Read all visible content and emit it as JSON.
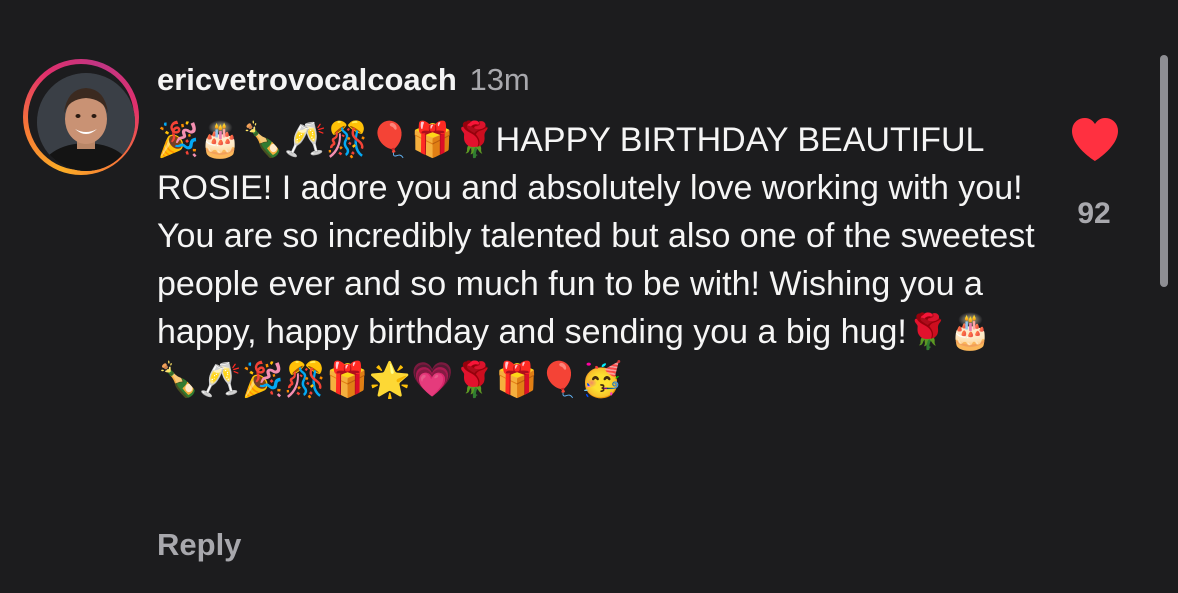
{
  "comment": {
    "username": "ericvetrovocalcoach",
    "timestamp": "13m",
    "text": "🎉🎂🍾🥂🎊🎈🎁🌹HAPPY BIRTHDAY BEAUTIFUL ROSIE! I adore you and absolutely love working with you! You are so incredibly talented but also one of the sweetest people ever and so much fun to be with! Wishing you a happy, happy birthday and sending you a big hug!🌹🎂 🍾🥂🎉🎊🎁🌟💗🌹🎁🎈🥳",
    "like_count": "92",
    "reply_label": "Reply",
    "liked": true
  },
  "colors": {
    "background": "#1c1c1e",
    "heart": "#ff3040",
    "text_primary": "#f5f5f5",
    "text_secondary": "#a8a8ad"
  },
  "icons": {
    "like": "heart-icon",
    "avatar": "avatar-photo"
  }
}
